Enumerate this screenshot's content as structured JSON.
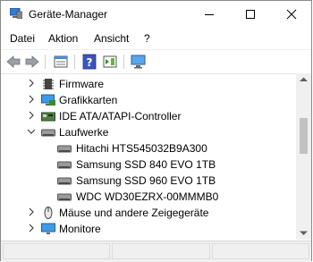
{
  "window": {
    "title": "Geräte-Manager"
  },
  "menu": {
    "items": [
      "Datei",
      "Aktion",
      "Ansicht",
      "?"
    ]
  },
  "tree": {
    "rows": [
      {
        "label": "Firmware",
        "expanded": false,
        "level": 1
      },
      {
        "label": "Grafikkarten",
        "expanded": false,
        "level": 1
      },
      {
        "label": "IDE ATA/ATAPI-Controller",
        "expanded": false,
        "level": 1
      },
      {
        "label": "Laufwerke",
        "expanded": true,
        "level": 1
      },
      {
        "label": "Hitachi HTS545032B9A300",
        "level": 2
      },
      {
        "label": "Samsung SSD 840 EVO 1TB",
        "level": 2
      },
      {
        "label": "Samsung SSD 960 EVO 1TB",
        "level": 2
      },
      {
        "label": "WDC WD30EZRX-00MMMB0",
        "level": 2
      },
      {
        "label": "Mäuse und andere Zeigegeräte",
        "expanded": false,
        "level": 1
      },
      {
        "label": "Monitore",
        "expanded": false,
        "level": 1
      }
    ]
  }
}
